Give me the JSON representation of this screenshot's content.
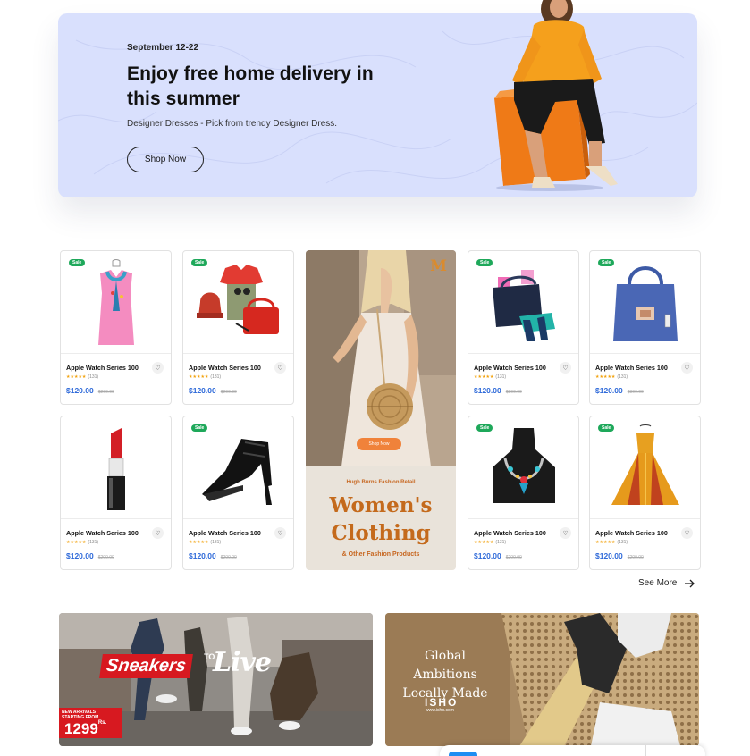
{
  "hero": {
    "date": "September 12-22",
    "title": "Enjoy free home delivery in this summer",
    "subtitle": "Designer Dresses - Pick from trendy Designer Dress.",
    "button": "Shop Now",
    "background": "#d9e0fd"
  },
  "products": [
    {
      "badge": "Sale",
      "name": "Apple Watch Series 100",
      "stars": "★★★★★",
      "count": "(131)",
      "price": "$120.00",
      "old_price": "$200.00",
      "image": "pink-top-with-scarf"
    },
    {
      "badge": "Sale",
      "name": "Apple Watch Series 100",
      "stars": "★★★★★",
      "count": "(131)",
      "price": "$120.00",
      "old_price": "$200.00",
      "image": "outfit-set-bag-hat"
    },
    {
      "badge": "Sale",
      "name": "Apple Watch Series 100",
      "stars": "★★★★★",
      "count": "(131)",
      "price": "$120.00",
      "old_price": "$200.00",
      "image": "bag-and-sandals"
    },
    {
      "badge": "Sale",
      "name": "Apple Watch Series 100",
      "stars": "★★★★★",
      "count": "(131)",
      "price": "$120.00",
      "old_price": "$300.00",
      "image": "blue-handbag"
    },
    {
      "badge": "",
      "name": "Apple Watch Series 100",
      "stars": "★★★★★",
      "count": "(131)",
      "price": "$120.00",
      "old_price": "$200.00",
      "image": "red-lipstick"
    },
    {
      "badge": "Sale",
      "name": "Apple Watch Series 100",
      "stars": "★★★★★",
      "count": "(131)",
      "price": "$120.00",
      "old_price": "$200.00",
      "image": "black-high-heels"
    },
    {
      "badge": "Sale",
      "name": "Apple Watch Series 100",
      "stars": "★★★★★",
      "count": "(131)",
      "price": "$120.00",
      "old_price": "$200.00",
      "image": "statement-necklace"
    },
    {
      "badge": "Sale",
      "name": "Apple Watch Series 100",
      "stars": "★★★★★",
      "count": "(131)",
      "price": "$120.00",
      "old_price": "$200.00",
      "image": "golden-gown"
    }
  ],
  "promo": {
    "logo": "M",
    "button": "Shop Now",
    "kicker": "Hugh Burns Fashion Retail",
    "title_line1": "Women's",
    "title_line2": "Clothing",
    "footer": "& Other Fashion Products",
    "accent": "#c46a1c"
  },
  "see_more": {
    "label": "See More",
    "icon": "arrow-right-icon"
  },
  "banners": {
    "sneakers": {
      "word": "Sneakers",
      "to": "TO",
      "live": "Live",
      "new_arrivals": "NEW ARRIVALS STARTING FROM",
      "price": "1299",
      "price_suffix": "Rs."
    },
    "global": {
      "line1": "Global Ambitions",
      "line2": "Locally Made",
      "logo": "ISHO",
      "url": "www.isho.com"
    }
  }
}
